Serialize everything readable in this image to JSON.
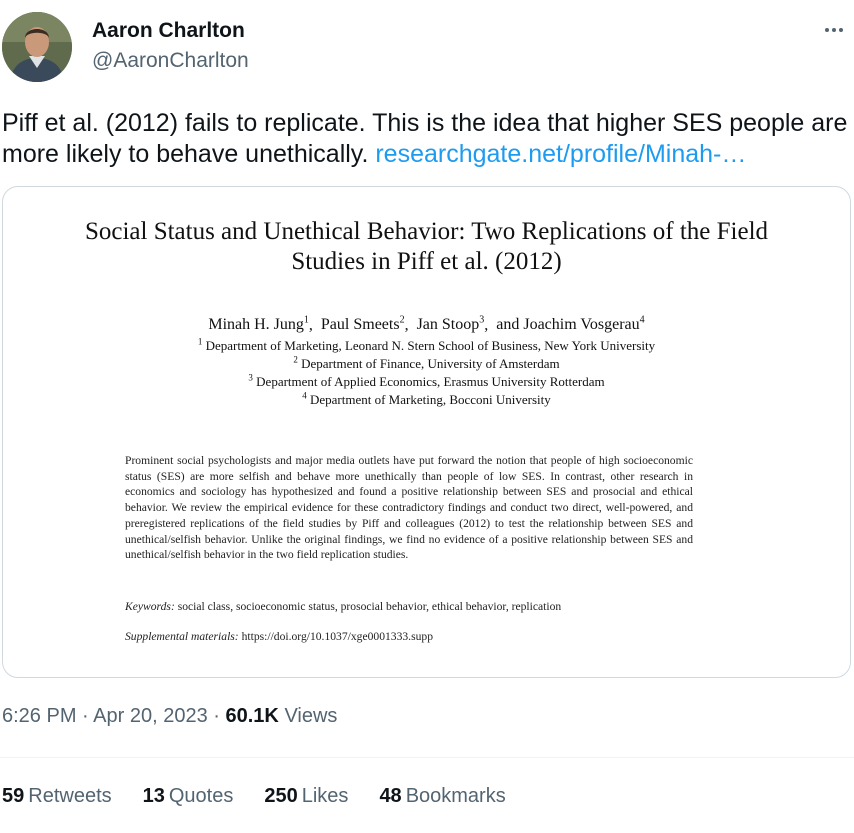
{
  "author": {
    "name": "Aaron Charlton",
    "handle": "@AaronCharlton"
  },
  "tweet": {
    "text": "Piff et al. (2012) fails to replicate. This is the idea that higher SES people are more likely to behave unethically.",
    "link": "researchgate.net/profile/Minah-…"
  },
  "paper": {
    "title_line1": "Social Status and Unethical Behavior: Two Replications of the Field",
    "title_line2": "Studies in Piff et al. (2012)",
    "authors": [
      {
        "name": "Minah H. Jung",
        "sup": "1"
      },
      {
        "name": "Paul Smeets",
        "sup": "2"
      },
      {
        "name": "Jan Stoop",
        "sup": "3"
      },
      {
        "name": "and Joachim Vosgerau",
        "sup": "4"
      }
    ],
    "affiliations": [
      {
        "sup": "1",
        "text": "Department of Marketing, Leonard N. Stern School of Business, New York University"
      },
      {
        "sup": "2",
        "text": "Department of Finance, University of Amsterdam"
      },
      {
        "sup": "3",
        "text": "Department of Applied Economics, Erasmus University Rotterdam"
      },
      {
        "sup": "4",
        "text": "Department of Marketing, Bocconi University"
      }
    ],
    "abstract": "Prominent social psychologists and major media outlets have put forward the notion that people of high socioeconomic status (SES) are more selfish and behave more unethically than people of low SES. In contrast, other research in economics and sociology has hypothesized and found a positive relationship between SES and prosocial and ethical behavior. We review the empirical evidence for these contradictory findings and conduct two direct, well-powered, and preregistered replications of the field studies by Piff and colleagues (2012) to test the relationship between SES and unethical/selfish behavior. Unlike the original findings, we find no evidence of a positive relationship between SES and unethical/selfish behavior in the two field replication studies.",
    "keywords_label": "Keywords:",
    "keywords": "social class, socioeconomic status, prosocial behavior, ethical behavior, replication",
    "supp_label": "Supplemental materials:",
    "supp_url": "https://doi.org/10.1037/xge0001333.supp"
  },
  "meta": {
    "time": "6:26 PM",
    "sep1": "·",
    "date": "Apr 20, 2023",
    "sep2": "·",
    "views_count": "60.1K",
    "views_label": "Views"
  },
  "stats": {
    "retweets": {
      "count": "59",
      "label": "Retweets"
    },
    "quotes": {
      "count": "13",
      "label": "Quotes"
    },
    "likes": {
      "count": "250",
      "label": "Likes"
    },
    "bookmarks": {
      "count": "48",
      "label": "Bookmarks"
    }
  },
  "colors": {
    "link": "#1d9bf0",
    "secondary_text": "#536471",
    "primary_text": "#0f1419",
    "border": "#cfd9de"
  },
  "icons": {
    "more": "more-horizontal-icon"
  }
}
